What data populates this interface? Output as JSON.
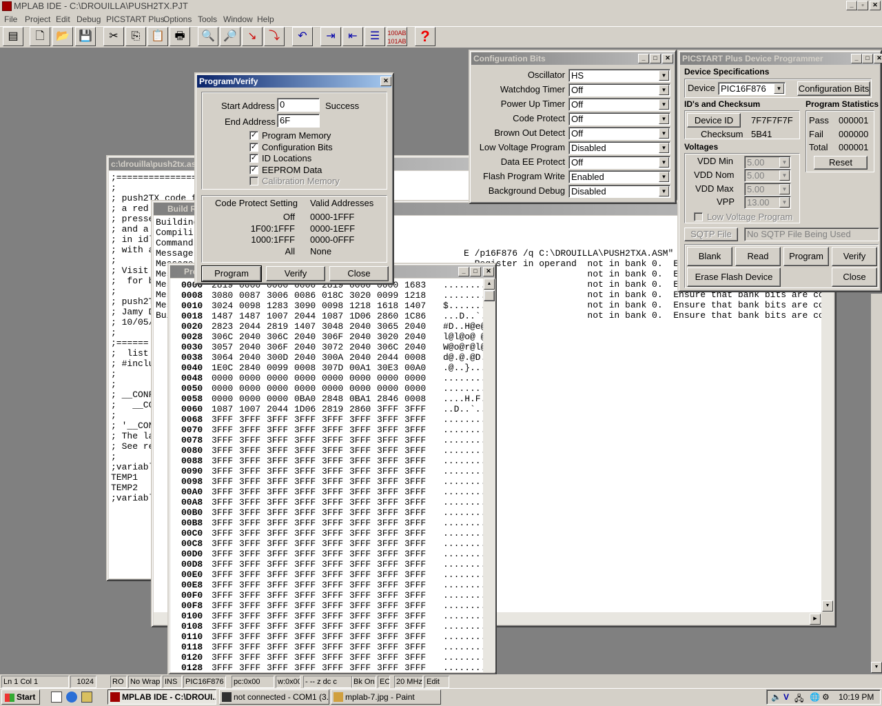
{
  "app": {
    "title": "MPLAB IDE - C:\\DROUILLA\\PUSH2TX.PJT"
  },
  "menu": [
    "File",
    "Project",
    "Edit",
    "Debug",
    "PICSTART Plus",
    "Options",
    "Tools",
    "Window",
    "Help"
  ],
  "toolbar": {
    "icons": [
      "layout-icon",
      "new-icon",
      "open-icon",
      "save-icon",
      "cut-icon",
      "copy-icon",
      "paste-icon",
      "print-icon",
      "find-icon",
      "find-next-icon",
      "step-icon",
      "step-over-icon",
      "undo-icon",
      "indent-icon",
      "outdent-icon",
      "mark-icon",
      "hex-icon",
      "help-icon"
    ]
  },
  "source_window": {
    "title": "c:\\drouilla\\push2tx.asm",
    "lines": [
      ";===================================================",
      ";",
      "; push2TX code f",
      "; a red",
      "; presse",
      "; and a",
      "; in idl",
      "; with a",
      ";",
      "; Visit",
      ";  for b",
      ";",
      "; push2T",
      "; Jamy D",
      "; 10/05/",
      ";",
      ";======",
      "",
      ";  list p=",
      "; #includ",
      "",
      "",
      "",
      "",
      ";",
      ";",
      "; __CONF",
      ";   __CONF",
      ";",
      "; '__CON",
      "; The la",
      "; See re",
      ";",
      "",
      ";variabl",
      "TEMP1",
      "TEMP2",
      ";variabl"
    ]
  },
  "build_window": {
    "title": "Build Results",
    "lines": [
      "Building",
      "",
      "Compili",
      "Command",
      "Message",
      "Message",
      "Message",
      "Message",
      "Message",
      "Message",
      "",
      "Build"
    ],
    "right_lines": [
      "",
      "",
      "",
      "E /p16F876 /q C:\\DROUILLA\\PUSH2TXA.ASM\"",
      "  Register in operand  not in bank 0.  Ensure that bank bits are correct.",
      "                       not in bank 0.  Ensure that bank bits are correct.",
      "                       not in bank 0.  Ensure that bank bits are correct.",
      "                       not in bank 0.  Ensure that bank bits are correct.",
      "                       not in bank 0.  Ensure that bank bits are correct.",
      "                       not in bank 0.  Ensure that bank bits are correct."
    ]
  },
  "program_memory": {
    "title": "Program Memory",
    "rows": [
      [
        "0000",
        "2819",
        "0000",
        "0000",
        "0000",
        "2819",
        "0000",
        "0000",
        "1683",
        "........"
      ],
      [
        "0008",
        "3080",
        "0087",
        "3006",
        "0086",
        "018C",
        "3020",
        "0099",
        "1218",
        "........"
      ],
      [
        "0010",
        "3024",
        "0098",
        "1283",
        "3090",
        "0098",
        "1218",
        "1618",
        "1407",
        "$......."
      ],
      [
        "0018",
        "1487",
        "1487",
        "1007",
        "2044",
        "1087",
        "1D06",
        "2860",
        "1C86",
        "...D..`."
      ],
      [
        "0020",
        "2823",
        "2044",
        "2819",
        "1407",
        "3048",
        "2040",
        "3065",
        "2040",
        "#D..H@e@"
      ],
      [
        "0028",
        "306C",
        "2040",
        "306C",
        "2040",
        "306F",
        "2040",
        "3020",
        "2040",
        "l@l@o@ @"
      ],
      [
        "0030",
        "3057",
        "2040",
        "306F",
        "2040",
        "3072",
        "2040",
        "306C",
        "2040",
        "W@o@r@l@"
      ],
      [
        "0038",
        "3064",
        "2040",
        "300D",
        "2040",
        "300A",
        "2040",
        "2044",
        "0008",
        "d@.@.@D."
      ],
      [
        "0040",
        "1E0C",
        "2840",
        "0099",
        "0008",
        "307D",
        "00A1",
        "30E3",
        "00A0",
        ".@..}..."
      ],
      [
        "0048",
        "0000",
        "0000",
        "0000",
        "0000",
        "0000",
        "0000",
        "0000",
        "0000",
        "........"
      ],
      [
        "0050",
        "0000",
        "0000",
        "0000",
        "0000",
        "0000",
        "0000",
        "0000",
        "0000",
        "........"
      ],
      [
        "0058",
        "0000",
        "0000",
        "0000",
        "0BA0",
        "2848",
        "0BA1",
        "2846",
        "0008",
        "....H.F."
      ],
      [
        "0060",
        "1087",
        "1007",
        "2044",
        "1D06",
        "2819",
        "2860",
        "3FFF",
        "3FFF",
        "..D..`.."
      ],
      [
        "0068",
        "3FFF",
        "3FFF",
        "3FFF",
        "3FFF",
        "3FFF",
        "3FFF",
        "3FFF",
        "3FFF",
        "........"
      ],
      [
        "0070",
        "3FFF",
        "3FFF",
        "3FFF",
        "3FFF",
        "3FFF",
        "3FFF",
        "3FFF",
        "3FFF",
        "........"
      ],
      [
        "0078",
        "3FFF",
        "3FFF",
        "3FFF",
        "3FFF",
        "3FFF",
        "3FFF",
        "3FFF",
        "3FFF",
        "........"
      ],
      [
        "0080",
        "3FFF",
        "3FFF",
        "3FFF",
        "3FFF",
        "3FFF",
        "3FFF",
        "3FFF",
        "3FFF",
        "........"
      ],
      [
        "0088",
        "3FFF",
        "3FFF",
        "3FFF",
        "3FFF",
        "3FFF",
        "3FFF",
        "3FFF",
        "3FFF",
        "........"
      ],
      [
        "0090",
        "3FFF",
        "3FFF",
        "3FFF",
        "3FFF",
        "3FFF",
        "3FFF",
        "3FFF",
        "3FFF",
        "........"
      ],
      [
        "0098",
        "3FFF",
        "3FFF",
        "3FFF",
        "3FFF",
        "3FFF",
        "3FFF",
        "3FFF",
        "3FFF",
        "........"
      ],
      [
        "00A0",
        "3FFF",
        "3FFF",
        "3FFF",
        "3FFF",
        "3FFF",
        "3FFF",
        "3FFF",
        "3FFF",
        "........"
      ],
      [
        "00A8",
        "3FFF",
        "3FFF",
        "3FFF",
        "3FFF",
        "3FFF",
        "3FFF",
        "3FFF",
        "3FFF",
        "........"
      ],
      [
        "00B0",
        "3FFF",
        "3FFF",
        "3FFF",
        "3FFF",
        "3FFF",
        "3FFF",
        "3FFF",
        "3FFF",
        "........"
      ],
      [
        "00B8",
        "3FFF",
        "3FFF",
        "3FFF",
        "3FFF",
        "3FFF",
        "3FFF",
        "3FFF",
        "3FFF",
        "........"
      ],
      [
        "00C0",
        "3FFF",
        "3FFF",
        "3FFF",
        "3FFF",
        "3FFF",
        "3FFF",
        "3FFF",
        "3FFF",
        "........"
      ],
      [
        "00C8",
        "3FFF",
        "3FFF",
        "3FFF",
        "3FFF",
        "3FFF",
        "3FFF",
        "3FFF",
        "3FFF",
        "........"
      ],
      [
        "00D0",
        "3FFF",
        "3FFF",
        "3FFF",
        "3FFF",
        "3FFF",
        "3FFF",
        "3FFF",
        "3FFF",
        "........"
      ],
      [
        "00D8",
        "3FFF",
        "3FFF",
        "3FFF",
        "3FFF",
        "3FFF",
        "3FFF",
        "3FFF",
        "3FFF",
        "........"
      ],
      [
        "00E0",
        "3FFF",
        "3FFF",
        "3FFF",
        "3FFF",
        "3FFF",
        "3FFF",
        "3FFF",
        "3FFF",
        "........"
      ],
      [
        "00E8",
        "3FFF",
        "3FFF",
        "3FFF",
        "3FFF",
        "3FFF",
        "3FFF",
        "3FFF",
        "3FFF",
        "........"
      ],
      [
        "00F0",
        "3FFF",
        "3FFF",
        "3FFF",
        "3FFF",
        "3FFF",
        "3FFF",
        "3FFF",
        "3FFF",
        "........"
      ],
      [
        "00F8",
        "3FFF",
        "3FFF",
        "3FFF",
        "3FFF",
        "3FFF",
        "3FFF",
        "3FFF",
        "3FFF",
        "........"
      ],
      [
        "0100",
        "3FFF",
        "3FFF",
        "3FFF",
        "3FFF",
        "3FFF",
        "3FFF",
        "3FFF",
        "3FFF",
        "........"
      ],
      [
        "0108",
        "3FFF",
        "3FFF",
        "3FFF",
        "3FFF",
        "3FFF",
        "3FFF",
        "3FFF",
        "3FFF",
        "........"
      ],
      [
        "0110",
        "3FFF",
        "3FFF",
        "3FFF",
        "3FFF",
        "3FFF",
        "3FFF",
        "3FFF",
        "3FFF",
        "........"
      ],
      [
        "0118",
        "3FFF",
        "3FFF",
        "3FFF",
        "3FFF",
        "3FFF",
        "3FFF",
        "3FFF",
        "3FFF",
        "........"
      ],
      [
        "0120",
        "3FFF",
        "3FFF",
        "3FFF",
        "3FFF",
        "3FFF",
        "3FFF",
        "3FFF",
        "3FFF",
        "........"
      ],
      [
        "0128",
        "3FFF",
        "3FFF",
        "3FFF",
        "3FFF",
        "3FFF",
        "3FFF",
        "3FFF",
        "3FFF",
        "........"
      ]
    ]
  },
  "program_verify": {
    "title": "Program/Verify",
    "start_label": "Start Address",
    "start_value": "0",
    "status": "Success",
    "end_label": "End Address",
    "end_value": "6F",
    "checks": [
      {
        "label": "Program Memory",
        "mark": "✓"
      },
      {
        "label": "Configuration Bits",
        "mark": "✓"
      },
      {
        "label": "ID Locations",
        "mark": "✓"
      },
      {
        "label": "EEPROM Data",
        "mark": "✓"
      },
      {
        "label": "Calibration Memory",
        "mark": ""
      }
    ],
    "cp_header": "Code Protect Setting",
    "va_header": "Valid Addresses",
    "cp_rows": [
      [
        "Off",
        "0000-1FFF"
      ],
      [
        "1F00:1FFF",
        "0000-1EFF"
      ],
      [
        "1000:1FFF",
        "0000-0FFF"
      ],
      [
        "All",
        "None"
      ]
    ],
    "buttons": {
      "program": "Program",
      "verify": "Verify",
      "close": "Close"
    }
  },
  "config_bits": {
    "title": "Configuration Bits",
    "rows": [
      [
        "Oscillator",
        "HS"
      ],
      [
        "Watchdog Timer",
        "Off"
      ],
      [
        "Power Up Timer",
        "Off"
      ],
      [
        "Code Protect",
        "Off"
      ],
      [
        "Brown Out Detect",
        "Off"
      ],
      [
        "Low Voltage Program",
        "Disabled"
      ],
      [
        "Data EE Protect",
        "Off"
      ],
      [
        "Flash Program Write",
        "Enabled"
      ],
      [
        "Background Debug",
        "Disabled"
      ]
    ]
  },
  "programmer": {
    "title": "PICSTART Plus Device Programmer",
    "device_spec": "Device Specifications",
    "device_label": "Device",
    "device_value": "PIC16F876",
    "config_button": "Configuration Bits",
    "ids_header": "ID's and Checksum",
    "device_id_button": "Device ID",
    "device_id_value": "7F7F7F7F",
    "checksum_label": "Checksum",
    "checksum_value": "5B41",
    "stats_header": "Program Statistics",
    "pass_label": "Pass",
    "pass_value": "000001",
    "fail_label": "Fail",
    "fail_value": "000000",
    "total_label": "Total",
    "total_value": "000001",
    "reset": "Reset",
    "voltages_header": "Voltages",
    "vdd_min_label": "VDD Min",
    "vdd_min": "5.00",
    "vdd_nom_label": "VDD Nom",
    "vdd_nom": "5.00",
    "vdd_max_label": "VDD Max",
    "vdd_max": "5.00",
    "vpp_label": "VPP",
    "vpp": "13.00",
    "low_voltage": "Low Voltage Program",
    "sqtp_button": "SQTP File",
    "sqtp_value": "No SQTP File Being Used",
    "buttons": {
      "blank": "Blank",
      "read": "Read",
      "program": "Program",
      "verify": "Verify",
      "erase": "Erase Flash Device",
      "close": "Close"
    }
  },
  "statusbar": [
    "Ln 1 Col 1",
    "1024",
    "RO",
    "No Wrap",
    "INS",
    "PIC16F876",
    "pc:0x00",
    "w:0x00",
    "- -- z dc c",
    "Bk On",
    "EO",
    "20 MHz",
    "Edit"
  ],
  "taskbar": {
    "start": "Start",
    "tasks": [
      "MPLAB IDE - C:\\DROUI...",
      "not connected - COM1 (3...",
      "mplab-7.jpg - Paint"
    ],
    "clock": "10:19 PM"
  },
  "colors": {
    "desktop": "#808080",
    "titlebar": "#0a246a",
    "face": "#d4d0c8"
  }
}
